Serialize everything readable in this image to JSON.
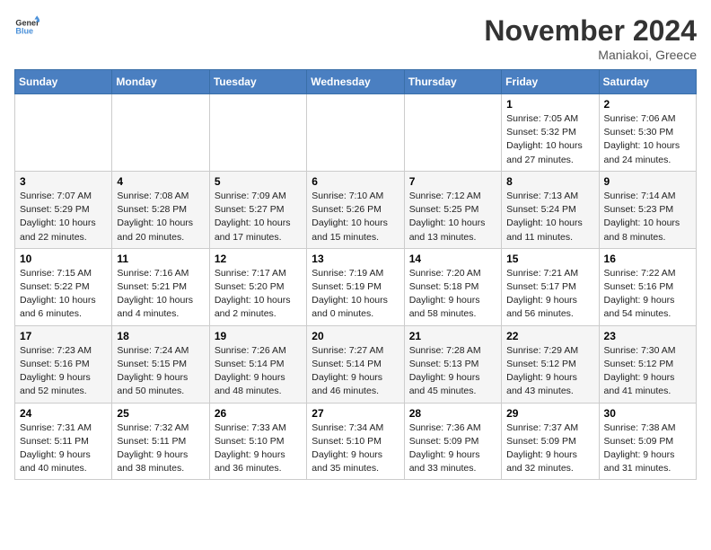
{
  "header": {
    "logo_line1": "General",
    "logo_line2": "Blue",
    "month": "November 2024",
    "location": "Maniakoi, Greece"
  },
  "weekdays": [
    "Sunday",
    "Monday",
    "Tuesday",
    "Wednesday",
    "Thursday",
    "Friday",
    "Saturday"
  ],
  "weeks": [
    [
      {
        "day": "",
        "info": ""
      },
      {
        "day": "",
        "info": ""
      },
      {
        "day": "",
        "info": ""
      },
      {
        "day": "",
        "info": ""
      },
      {
        "day": "",
        "info": ""
      },
      {
        "day": "1",
        "info": "Sunrise: 7:05 AM\nSunset: 5:32 PM\nDaylight: 10 hours and 27 minutes."
      },
      {
        "day": "2",
        "info": "Sunrise: 7:06 AM\nSunset: 5:30 PM\nDaylight: 10 hours and 24 minutes."
      }
    ],
    [
      {
        "day": "3",
        "info": "Sunrise: 7:07 AM\nSunset: 5:29 PM\nDaylight: 10 hours and 22 minutes."
      },
      {
        "day": "4",
        "info": "Sunrise: 7:08 AM\nSunset: 5:28 PM\nDaylight: 10 hours and 20 minutes."
      },
      {
        "day": "5",
        "info": "Sunrise: 7:09 AM\nSunset: 5:27 PM\nDaylight: 10 hours and 17 minutes."
      },
      {
        "day": "6",
        "info": "Sunrise: 7:10 AM\nSunset: 5:26 PM\nDaylight: 10 hours and 15 minutes."
      },
      {
        "day": "7",
        "info": "Sunrise: 7:12 AM\nSunset: 5:25 PM\nDaylight: 10 hours and 13 minutes."
      },
      {
        "day": "8",
        "info": "Sunrise: 7:13 AM\nSunset: 5:24 PM\nDaylight: 10 hours and 11 minutes."
      },
      {
        "day": "9",
        "info": "Sunrise: 7:14 AM\nSunset: 5:23 PM\nDaylight: 10 hours and 8 minutes."
      }
    ],
    [
      {
        "day": "10",
        "info": "Sunrise: 7:15 AM\nSunset: 5:22 PM\nDaylight: 10 hours and 6 minutes."
      },
      {
        "day": "11",
        "info": "Sunrise: 7:16 AM\nSunset: 5:21 PM\nDaylight: 10 hours and 4 minutes."
      },
      {
        "day": "12",
        "info": "Sunrise: 7:17 AM\nSunset: 5:20 PM\nDaylight: 10 hours and 2 minutes."
      },
      {
        "day": "13",
        "info": "Sunrise: 7:19 AM\nSunset: 5:19 PM\nDaylight: 10 hours and 0 minutes."
      },
      {
        "day": "14",
        "info": "Sunrise: 7:20 AM\nSunset: 5:18 PM\nDaylight: 9 hours and 58 minutes."
      },
      {
        "day": "15",
        "info": "Sunrise: 7:21 AM\nSunset: 5:17 PM\nDaylight: 9 hours and 56 minutes."
      },
      {
        "day": "16",
        "info": "Sunrise: 7:22 AM\nSunset: 5:16 PM\nDaylight: 9 hours and 54 minutes."
      }
    ],
    [
      {
        "day": "17",
        "info": "Sunrise: 7:23 AM\nSunset: 5:16 PM\nDaylight: 9 hours and 52 minutes."
      },
      {
        "day": "18",
        "info": "Sunrise: 7:24 AM\nSunset: 5:15 PM\nDaylight: 9 hours and 50 minutes."
      },
      {
        "day": "19",
        "info": "Sunrise: 7:26 AM\nSunset: 5:14 PM\nDaylight: 9 hours and 48 minutes."
      },
      {
        "day": "20",
        "info": "Sunrise: 7:27 AM\nSunset: 5:14 PM\nDaylight: 9 hours and 46 minutes."
      },
      {
        "day": "21",
        "info": "Sunrise: 7:28 AM\nSunset: 5:13 PM\nDaylight: 9 hours and 45 minutes."
      },
      {
        "day": "22",
        "info": "Sunrise: 7:29 AM\nSunset: 5:12 PM\nDaylight: 9 hours and 43 minutes."
      },
      {
        "day": "23",
        "info": "Sunrise: 7:30 AM\nSunset: 5:12 PM\nDaylight: 9 hours and 41 minutes."
      }
    ],
    [
      {
        "day": "24",
        "info": "Sunrise: 7:31 AM\nSunset: 5:11 PM\nDaylight: 9 hours and 40 minutes."
      },
      {
        "day": "25",
        "info": "Sunrise: 7:32 AM\nSunset: 5:11 PM\nDaylight: 9 hours and 38 minutes."
      },
      {
        "day": "26",
        "info": "Sunrise: 7:33 AM\nSunset: 5:10 PM\nDaylight: 9 hours and 36 minutes."
      },
      {
        "day": "27",
        "info": "Sunrise: 7:34 AM\nSunset: 5:10 PM\nDaylight: 9 hours and 35 minutes."
      },
      {
        "day": "28",
        "info": "Sunrise: 7:36 AM\nSunset: 5:09 PM\nDaylight: 9 hours and 33 minutes."
      },
      {
        "day": "29",
        "info": "Sunrise: 7:37 AM\nSunset: 5:09 PM\nDaylight: 9 hours and 32 minutes."
      },
      {
        "day": "30",
        "info": "Sunrise: 7:38 AM\nSunset: 5:09 PM\nDaylight: 9 hours and 31 minutes."
      }
    ]
  ]
}
